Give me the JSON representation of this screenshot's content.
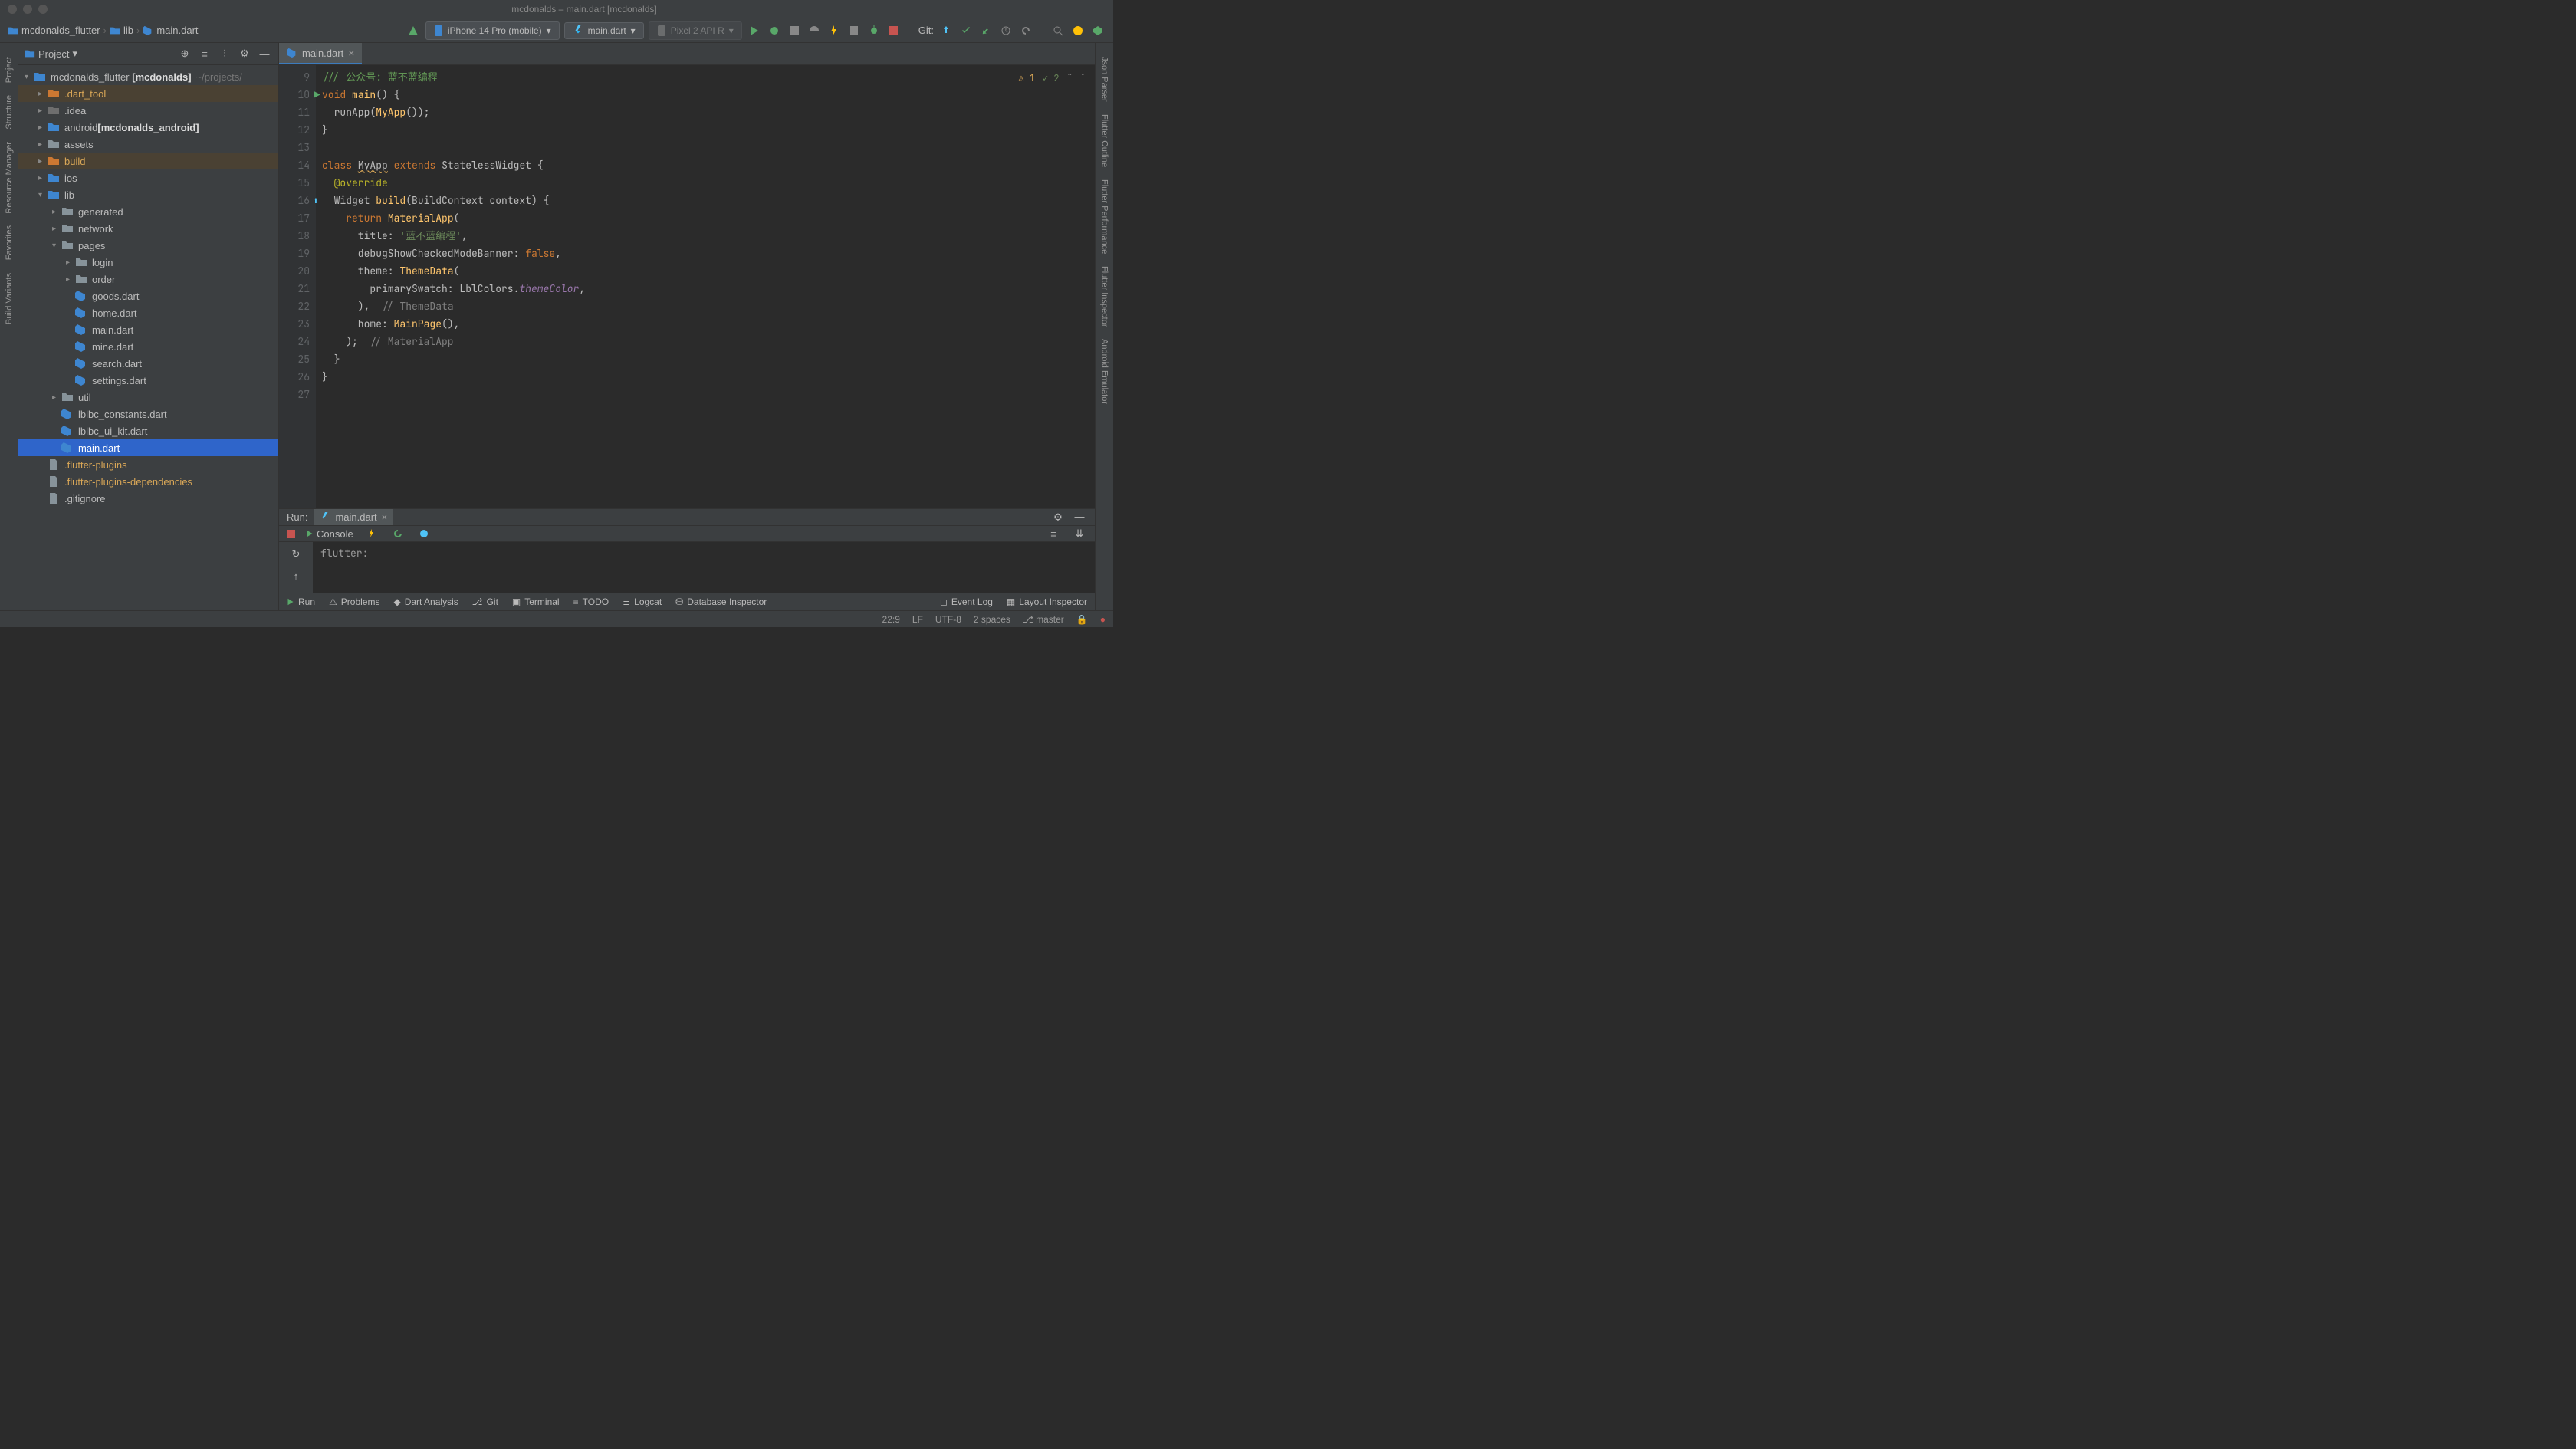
{
  "window": {
    "title": "mcdonalds – main.dart [mcdonalds]"
  },
  "breadcrumbs": [
    "mcdonalds_flutter",
    "lib",
    "main.dart"
  ],
  "toolbar": {
    "device": "iPhone 14 Pro (mobile)",
    "config": "main.dart",
    "emulator": "Pixel 2 API R",
    "git_label": "Git:"
  },
  "project": {
    "header": "Project",
    "root": {
      "name": "mcdonalds_flutter",
      "module": "[mcdonalds]",
      "path": "~/projects/"
    },
    "tree": [
      {
        "indent": 1,
        "chevron": ">",
        "name": ".dart_tool",
        "icon": "folder-orange",
        "highlight": true
      },
      {
        "indent": 1,
        "chevron": ">",
        "name": ".idea",
        "icon": "folder-grey"
      },
      {
        "indent": 1,
        "chevron": ">",
        "name": "android",
        "icon": "folder-blue",
        "bold": "[mcdonalds_android]"
      },
      {
        "indent": 1,
        "chevron": ">",
        "name": "assets",
        "icon": "folder"
      },
      {
        "indent": 1,
        "chevron": ">",
        "name": "build",
        "icon": "folder-orange",
        "highlight": true
      },
      {
        "indent": 1,
        "chevron": ">",
        "name": "ios",
        "icon": "folder-blue"
      },
      {
        "indent": 1,
        "chevron": "v",
        "name": "lib",
        "icon": "folder-blue"
      },
      {
        "indent": 2,
        "chevron": ">",
        "name": "generated",
        "icon": "folder"
      },
      {
        "indent": 2,
        "chevron": ">",
        "name": "network",
        "icon": "folder"
      },
      {
        "indent": 2,
        "chevron": "v",
        "name": "pages",
        "icon": "folder"
      },
      {
        "indent": 3,
        "chevron": ">",
        "name": "login",
        "icon": "folder"
      },
      {
        "indent": 3,
        "chevron": ">",
        "name": "order",
        "icon": "folder"
      },
      {
        "indent": 3,
        "chevron": "",
        "name": "goods.dart",
        "icon": "dart"
      },
      {
        "indent": 3,
        "chevron": "",
        "name": "home.dart",
        "icon": "dart"
      },
      {
        "indent": 3,
        "chevron": "",
        "name": "main.dart",
        "icon": "dart"
      },
      {
        "indent": 3,
        "chevron": "",
        "name": "mine.dart",
        "icon": "dart"
      },
      {
        "indent": 3,
        "chevron": "",
        "name": "search.dart",
        "icon": "dart"
      },
      {
        "indent": 3,
        "chevron": "",
        "name": "settings.dart",
        "icon": "dart"
      },
      {
        "indent": 2,
        "chevron": ">",
        "name": "util",
        "icon": "folder"
      },
      {
        "indent": 2,
        "chevron": "",
        "name": "lblbc_constants.dart",
        "icon": "dart"
      },
      {
        "indent": 2,
        "chevron": "",
        "name": "lblbc_ui_kit.dart",
        "icon": "dart"
      },
      {
        "indent": 2,
        "chevron": "",
        "name": "main.dart",
        "icon": "dart",
        "selected": true
      },
      {
        "indent": 1,
        "chevron": "",
        "name": ".flutter-plugins",
        "icon": "txt",
        "orange": true
      },
      {
        "indent": 1,
        "chevron": "",
        "name": ".flutter-plugins-dependencies",
        "icon": "txt",
        "orange": true
      },
      {
        "indent": 1,
        "chevron": "",
        "name": ".gitignore",
        "icon": "txt"
      }
    ]
  },
  "editor": {
    "tab": "main.dart",
    "indicators": {
      "warn": "1",
      "ok": "2"
    },
    "lines_start": 9,
    "lines": [
      {
        "n": 9,
        "html": "<span class='c-doc'>/// 公众号: 蓝不蓝编程</span>"
      },
      {
        "n": 10,
        "html": "<span class='c-keyword'>void</span> <span class='c-method'>main</span>() {",
        "gutter": "run"
      },
      {
        "n": 11,
        "html": "  runApp(<span class='c-method'>MyApp</span>());"
      },
      {
        "n": 12,
        "html": "}"
      },
      {
        "n": 13,
        "html": ""
      },
      {
        "n": 14,
        "html": "<span class='c-keyword'>class</span> <span class='underline-wavy'>MyApp</span> <span class='c-keyword'>extends</span> StatelessWidget {"
      },
      {
        "n": 15,
        "html": "  <span class='c-annotation'>@override</span>"
      },
      {
        "n": 16,
        "html": "  Widget <span class='c-method'>build</span>(BuildContext context) {",
        "gutter": "override"
      },
      {
        "n": 17,
        "html": "    <span class='c-keyword'>return</span> <span class='c-method'>MaterialApp</span>("
      },
      {
        "n": 18,
        "html": "      title: <span class='c-string'>'蓝不蓝编程'</span>,"
      },
      {
        "n": 19,
        "html": "      debugShowCheckedModeBanner: <span class='c-keyword'>false</span>,"
      },
      {
        "n": 20,
        "html": "      theme: <span class='c-method'>ThemeData</span>("
      },
      {
        "n": 21,
        "html": "        primarySwatch: LblColors.<span class='c-field'>themeColor</span>,"
      },
      {
        "n": 22,
        "html": "      ),  <span class='c-comment'>// ThemeData</span>"
      },
      {
        "n": 23,
        "html": "      home: <span class='c-method'>MainPage</span>(),"
      },
      {
        "n": 24,
        "html": "    );  <span class='c-comment'>// MaterialApp</span>"
      },
      {
        "n": 25,
        "html": "  }"
      },
      {
        "n": 26,
        "html": "}"
      },
      {
        "n": 27,
        "html": ""
      }
    ]
  },
  "run": {
    "label": "Run:",
    "tab": "main.dart",
    "console_label": "Console",
    "output": "flutter:"
  },
  "bottom_tools": {
    "run": "Run",
    "problems": "Problems",
    "dart_analysis": "Dart Analysis",
    "git": "Git",
    "terminal": "Terminal",
    "todo": "TODO",
    "logcat": "Logcat",
    "db_inspector": "Database Inspector",
    "event_log": "Event Log",
    "layout_inspector": "Layout Inspector"
  },
  "status": {
    "cursor": "22:9",
    "line_ending": "LF",
    "encoding": "UTF-8",
    "indent": "2 spaces",
    "branch": "master"
  },
  "left_tabs": [
    "Project",
    "Structure",
    "Resource Manager",
    "Favorites",
    "Build Variants"
  ],
  "right_tabs": [
    "Json Parser",
    "Flutter Outline",
    "Flutter Performance",
    "Flutter Inspector",
    "Android Emulator"
  ]
}
